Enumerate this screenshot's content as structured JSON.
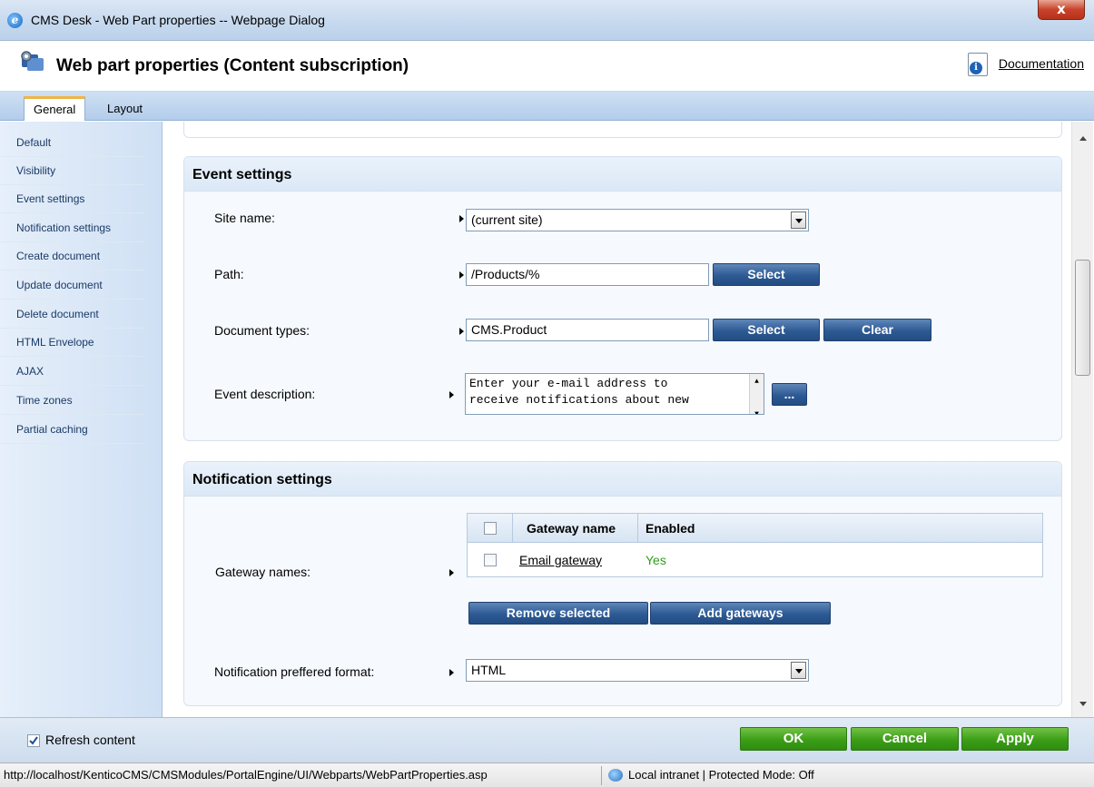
{
  "window": {
    "title": "CMS Desk - Web Part properties -- Webpage Dialog",
    "close_label": "x"
  },
  "header": {
    "title": "Web part properties (Content subscription)",
    "documentation_label": "Documentation"
  },
  "tabs": [
    {
      "label": "General"
    },
    {
      "label": "Layout"
    }
  ],
  "sidebar": {
    "items": [
      {
        "label": "Default"
      },
      {
        "label": "Visibility"
      },
      {
        "label": "Event settings"
      },
      {
        "label": "Notification settings"
      },
      {
        "label": "Create document"
      },
      {
        "label": "Update document"
      },
      {
        "label": "Delete document"
      },
      {
        "label": "HTML Envelope"
      },
      {
        "label": "AJAX"
      },
      {
        "label": "Time zones"
      },
      {
        "label": "Partial caching"
      }
    ]
  },
  "event_settings": {
    "heading": "Event settings",
    "site_name_label": "Site name:",
    "site_name_value": "(current site)",
    "path_label": "Path:",
    "path_value": "/Products/%",
    "path_select_label": "Select",
    "doc_types_label": "Document types:",
    "doc_types_value": "CMS.Product",
    "doc_types_select_label": "Select",
    "doc_types_clear_label": "Clear",
    "event_desc_label": "Event description:",
    "event_desc_line1": "Enter your e-mail address to",
    "event_desc_line2": "receive notifications about new",
    "event_desc_more_label": "..."
  },
  "notification_settings": {
    "heading": "Notification settings",
    "gateway_names_label": "Gateway names:",
    "grid": {
      "columns": [
        "Gateway name",
        "Enabled"
      ],
      "rows": [
        {
          "name": "Email gateway",
          "enabled": "Yes"
        }
      ]
    },
    "remove_selected_label": "Remove selected",
    "add_gateways_label": "Add gateways",
    "format_label": "Notification preffered format:",
    "format_value": "HTML"
  },
  "footer": {
    "refresh_label": "Refresh content",
    "refresh_checked": true,
    "ok_label": "OK",
    "cancel_label": "Cancel",
    "apply_label": "Apply"
  },
  "statusbar": {
    "url": "http://localhost/KenticoCMS/CMSModules/PortalEngine/UI/Webparts/WebPartProperties.asp",
    "zone": "Local intranet | Protected Mode: Off"
  },
  "colors": {
    "accent_blue": "#2d5a94",
    "accent_green": "#3b9e17",
    "tab_highlight": "#f0b542",
    "enabled_yes": "#2e9e1a"
  }
}
